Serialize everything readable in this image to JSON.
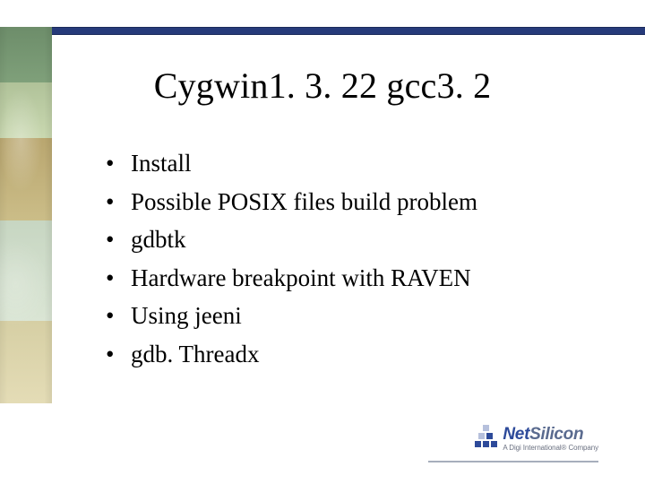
{
  "title": "Cygwin1. 3. 22 gcc3. 2",
  "bullets": [
    "Install",
    "Possible POSIX files build problem",
    "gdbtk",
    "Hardware breakpoint with RAVEN",
    "Using jeeni",
    "gdb. Threadx"
  ],
  "footer": {
    "brand_net": "Net",
    "brand_silicon": "Silicon",
    "tagline": "A Digi International® Company"
  }
}
